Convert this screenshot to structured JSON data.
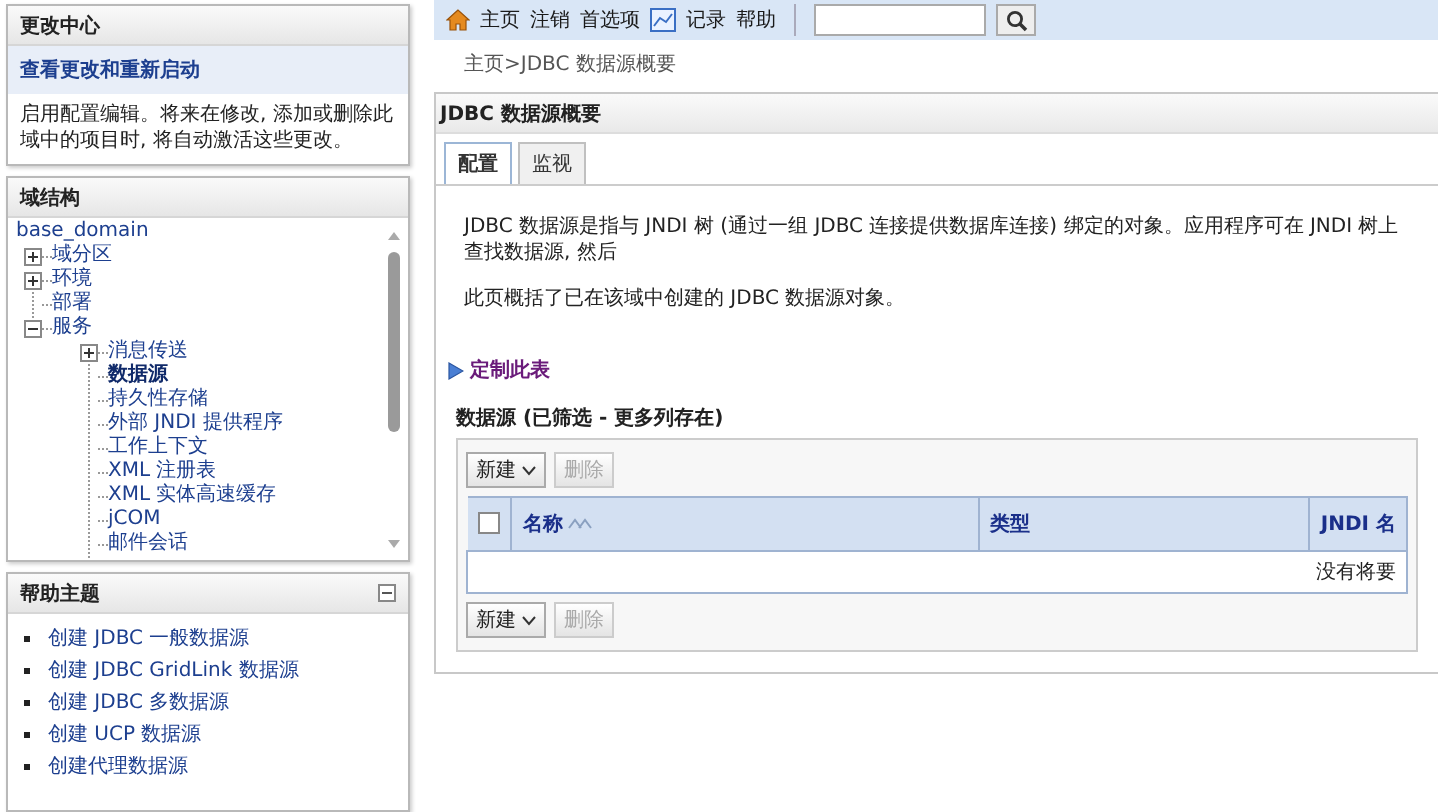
{
  "change_center": {
    "title": "更改中心",
    "link": "查看更改和重新启动",
    "message": "启用配置编辑。将来在修改, 添加或删除此域中的项目时, 将自动激活这些更改。"
  },
  "domain_structure": {
    "title": "域结构",
    "tree": [
      {
        "label": "base_domain",
        "selected": false,
        "children": [
          {
            "label": "域分区",
            "selected": false,
            "expanded": false
          },
          {
            "label": "环境",
            "selected": false,
            "expanded": false
          },
          {
            "label": "部署",
            "selected": false
          },
          {
            "label": "服务",
            "selected": false,
            "expanded": true,
            "children": [
              {
                "label": "消息传送",
                "selected": false,
                "expanded": false
              },
              {
                "label": "数据源",
                "selected": true
              },
              {
                "label": "持久性存储",
                "selected": false
              },
              {
                "label": "外部 JNDI 提供程序",
                "selected": false
              },
              {
                "label": "工作上下文",
                "selected": false
              },
              {
                "label": "XML 注册表",
                "selected": false
              },
              {
                "label": "XML 实体高速缓存",
                "selected": false
              },
              {
                "label": "jCOM",
                "selected": false
              },
              {
                "label": "邮件会话",
                "selected": false
              }
            ]
          }
        ]
      }
    ]
  },
  "help_topics": {
    "title": "帮助主题",
    "items": [
      "创建 JDBC 一般数据源",
      "创建 JDBC GridLink 数据源",
      "创建 JDBC 多数据源",
      "创建 UCP 数据源",
      "创建代理数据源"
    ]
  },
  "toolbar": {
    "items": [
      {
        "kind": "home",
        "label": "主页"
      },
      {
        "kind": "link",
        "label": "注销"
      },
      {
        "kind": "link",
        "label": "首选项"
      },
      {
        "kind": "record",
        "label": "记录"
      },
      {
        "kind": "link",
        "label": "帮助"
      }
    ]
  },
  "breadcrumb": {
    "links": [
      "主页"
    ],
    "current": ">JDBC 数据源概要"
  },
  "page": {
    "title": "JDBC 数据源概要",
    "tabs": [
      {
        "label": "配置",
        "selected": true
      },
      {
        "label": "监视",
        "selected": false
      }
    ],
    "paragraphs": [
      "JDBC 数据源是指与 JNDI 树 (通过一组 JDBC 连接提供数据库连接) 绑定的对象。应用程序可在 JNDI 树上查找数据源, 然后",
      "此页概括了已在该域中创建的 JDBC 数据源对象。"
    ],
    "customize_link": "定制此表",
    "table": {
      "title": "数据源 (已筛选 - 更多列存在)",
      "top_buttons": [
        {
          "kind": "dropdown",
          "label": "新建",
          "disabled": false
        },
        {
          "kind": "plain",
          "label": "删除",
          "disabled": true
        }
      ],
      "select_all": {
        "checked": false
      },
      "columns": [
        {
          "label": "名称",
          "sorted": true
        },
        {
          "label": "类型",
          "sorted": false
        },
        {
          "label": "JNDI 名",
          "sorted": false
        }
      ],
      "empty_message": "没有将要",
      "bottom_buttons": [
        {
          "kind": "dropdown",
          "label": "新建",
          "disabled": false
        },
        {
          "kind": "plain",
          "label": "删除",
          "disabled": true
        }
      ]
    }
  }
}
